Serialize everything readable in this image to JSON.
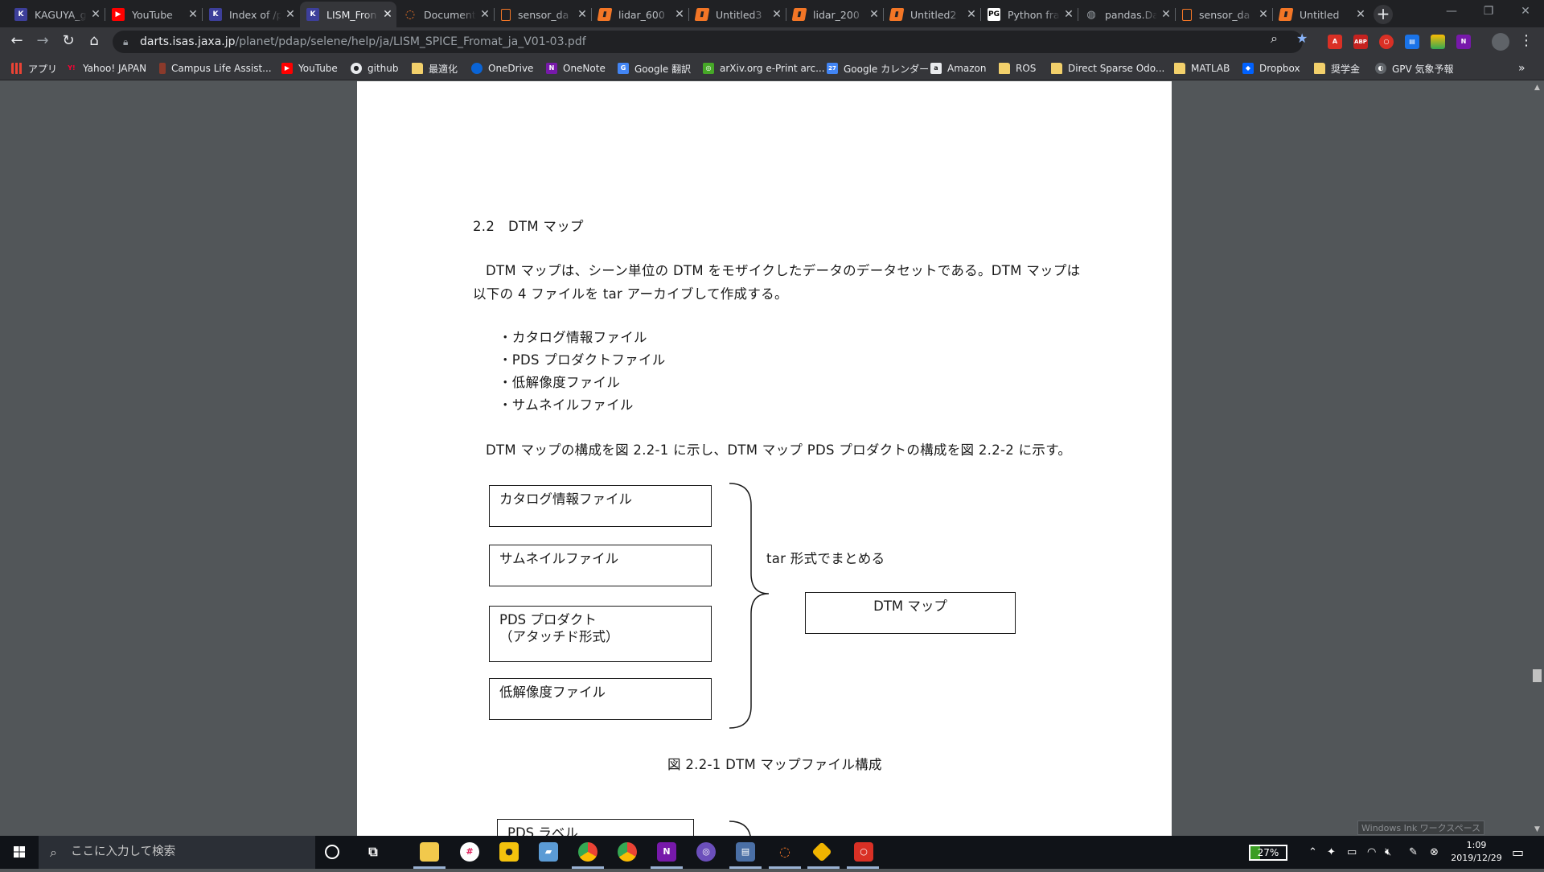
{
  "tabs": [
    {
      "title": "KAGUYA_g",
      "icon": "kaguya-icon",
      "active": false
    },
    {
      "title": "YouTube",
      "icon": "youtube-icon",
      "active": false
    },
    {
      "title": "Index of /p",
      "icon": "kaguya-icon",
      "active": false
    },
    {
      "title": "LISM_Fron",
      "icon": "kaguya-icon",
      "active": true
    },
    {
      "title": "Document",
      "icon": "jupyter-icon",
      "active": false
    },
    {
      "title": "sensor_da",
      "icon": "file-icon",
      "active": false
    },
    {
      "title": "lidar_600",
      "icon": "notebook-icon",
      "active": false
    },
    {
      "title": "Untitled3",
      "icon": "notebook-icon",
      "active": false
    },
    {
      "title": "lidar_200",
      "icon": "notebook-icon",
      "active": false
    },
    {
      "title": "Untitled2",
      "icon": "notebook-icon",
      "active": false
    },
    {
      "title": "Python fra",
      "icon": "pg-icon",
      "active": false
    },
    {
      "title": "pandas.Da",
      "icon": "globe-icon",
      "active": false
    },
    {
      "title": "sensor_da",
      "icon": "file-icon",
      "active": false
    },
    {
      "title": "Untitled",
      "icon": "notebook-icon",
      "active": false
    }
  ],
  "address": {
    "host": "darts.isas.jaxa.jp",
    "path": "/planet/pdap/selene/help/ja/LISM_SPICE_Fromat_ja_V01-03.pdf"
  },
  "bookmarks": [
    {
      "label": "アプリ",
      "icon": "apps-grid-icon"
    },
    {
      "label": "Yahoo! JAPAN",
      "icon": "yahoo-icon"
    },
    {
      "label": "Campus Life Assist...",
      "icon": "campus-icon"
    },
    {
      "label": "YouTube",
      "icon": "youtube-icon"
    },
    {
      "label": "github",
      "icon": "github-icon"
    },
    {
      "label": "最適化",
      "icon": "folder-icon"
    },
    {
      "label": "OneDrive",
      "icon": "onedrive-icon"
    },
    {
      "label": "OneNote",
      "icon": "onenote-icon"
    },
    {
      "label": "Google 翻訳",
      "icon": "translate-icon"
    },
    {
      "label": "arXiv.org e-Print arc...",
      "icon": "arxiv-icon"
    },
    {
      "label": "Google カレンダー",
      "icon": "calendar-icon"
    },
    {
      "label": "Amazon",
      "icon": "amazon-icon"
    },
    {
      "label": "ROS",
      "icon": "folder-icon"
    },
    {
      "label": "Direct Sparse Odo...",
      "icon": "folder-icon"
    },
    {
      "label": "MATLAB",
      "icon": "folder-icon"
    },
    {
      "label": "Dropbox",
      "icon": "dropbox-icon"
    },
    {
      "label": "奨学金",
      "icon": "folder-icon"
    },
    {
      "label": "GPV 気象予報",
      "icon": "gpv-icon"
    }
  ],
  "bookmarks_overflow": "»",
  "document": {
    "heading": "2.2　DTM マップ",
    "para_line1": "DTM マップは、シーン単位の DTM をモザイクしたデータのデータセットである。DTM マップは",
    "para_line2": "以下の 4 ファイルを tar アーカイブして作成する。",
    "bullets": [
      "・カタログ情報ファイル",
      "・PDS プロダクトファイル",
      "・低解像度ファイル",
      "・サムネイルファイル"
    ],
    "para2": "DTM マップの構成を図 2.2-1 に示し、DTM マップ PDS プロダクトの構成を図 2.2-2 に示す。",
    "diagram": {
      "boxes": [
        "カタログ情報ファイル",
        "サムネイルファイル",
        "PDS プロダクト\n（アタッチド形式）",
        "低解像度ファイル"
      ],
      "brace_label": "tar 形式でまとめる",
      "result": "DTM マップ"
    },
    "figure_caption": "図 2.2-1 DTM マップファイル構成",
    "next_box": "PDS ラベル"
  },
  "ink_workspace": "Windows Ink ワークスペース",
  "taskbar": {
    "search_placeholder": "ここに入力して検索",
    "battery_percent": "27%",
    "battery_level": 0.27,
    "time": "1:09",
    "date": "2019/12/29"
  }
}
